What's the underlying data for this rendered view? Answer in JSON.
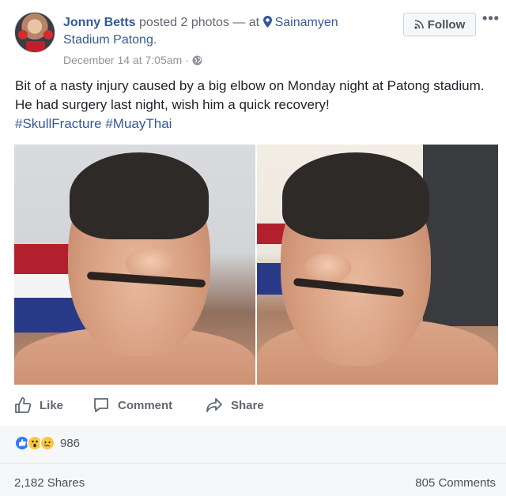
{
  "header": {
    "author": "Jonny Betts",
    "action": " posted 2 photos — at ",
    "place_line1": "Sainamyen",
    "place_line2": "Stadium Patong",
    "place_end": ".",
    "timestamp": "December 14 at 7:05am",
    "follow_label": "Follow",
    "more_label": "•••"
  },
  "post": {
    "text": "Bit of a nasty injury caused by a big elbow on Monday night at Patong stadium. He had surgery last night, wish him a quick recovery!",
    "hashtags": [
      "#SkullFracture",
      "#MuayThai"
    ]
  },
  "actions": {
    "like": "Like",
    "comment": "Comment",
    "share": "Share"
  },
  "stats": {
    "reaction_count": "986",
    "shares": "2,182 Shares",
    "comments": "805 Comments"
  },
  "icons": {
    "avatar": "avatar-image",
    "pin": "location-pin-icon",
    "globe": "globe-icon",
    "follow": "rss-icon",
    "more": "more-icon",
    "like": "thumbs-up-icon",
    "comment": "comment-bubble-icon",
    "share": "share-arrow-icon",
    "reactions": [
      "like-reaction-icon",
      "wow-reaction-icon",
      "sad-reaction-icon"
    ]
  },
  "colors": {
    "link": "#365899",
    "meta": "#90949c",
    "reaction_like": "#2f7bf5",
    "reaction_emoji": "#f7c93f"
  }
}
